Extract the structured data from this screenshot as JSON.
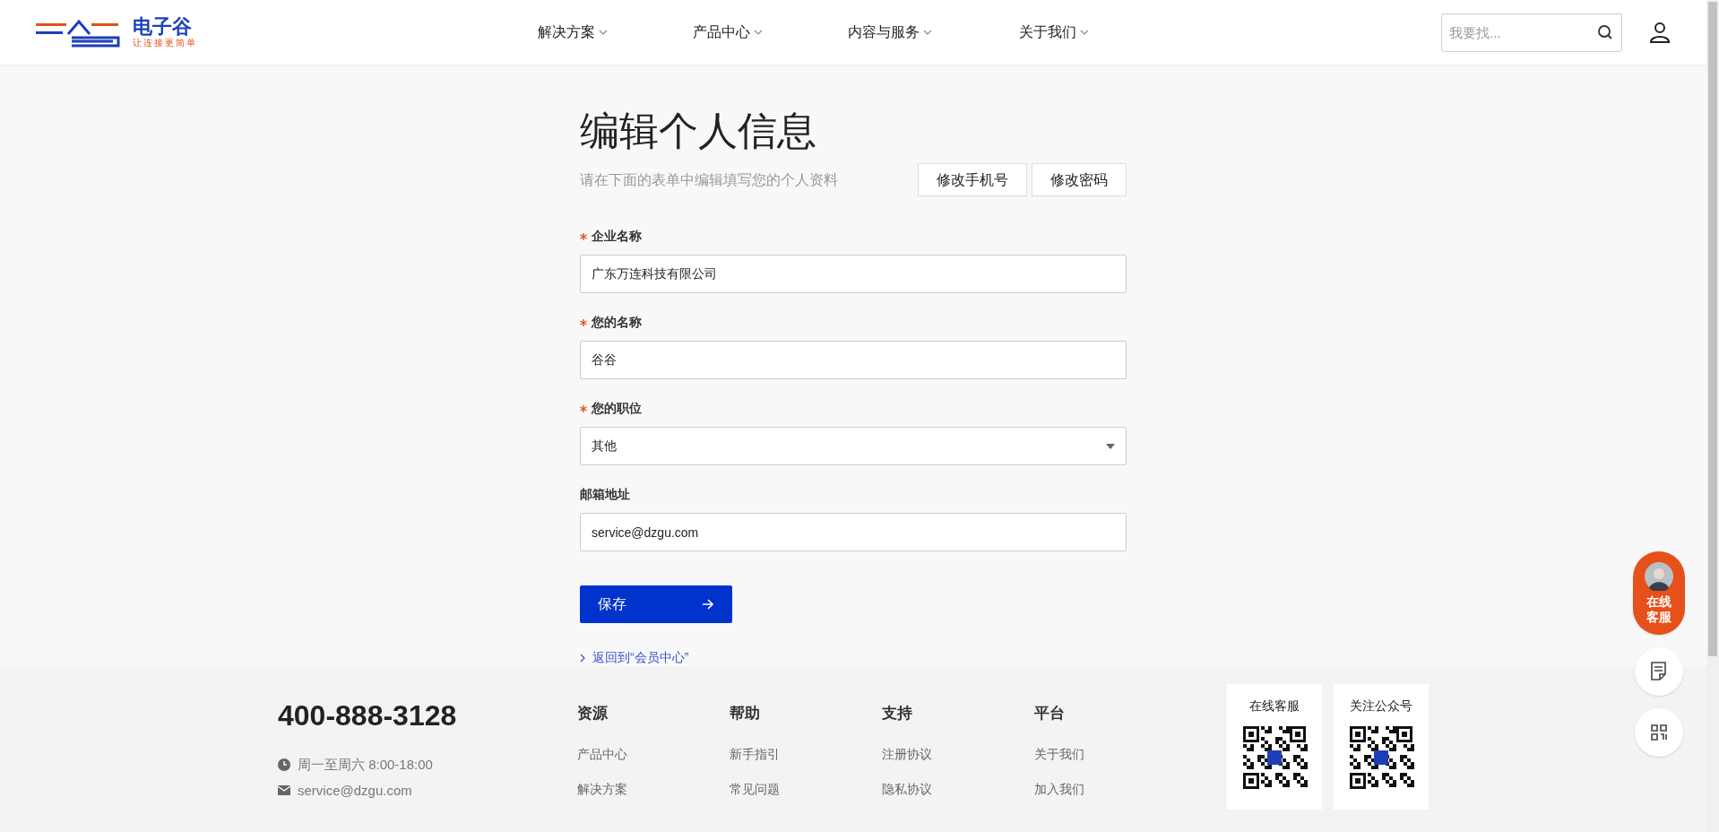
{
  "header": {
    "logo": {
      "name": "电子谷",
      "tagline": "让连接更简单"
    },
    "nav": [
      {
        "label": "解决方案",
        "selected": false
      },
      {
        "label": "产品中心",
        "selected": false
      },
      {
        "label": "内容与服务",
        "selected": false
      },
      {
        "label": "关于我们",
        "selected": false
      }
    ],
    "search": {
      "placeholder": "我要找..."
    }
  },
  "form": {
    "title": "编辑个人信息",
    "subtitle": "请在下面的表单中编辑填写您的个人资料",
    "actions": [
      "修改手机号",
      "修改密码"
    ],
    "fields": [
      {
        "kind": "text",
        "label": "企业名称",
        "required": true,
        "value": "广东万连科技有限公司"
      },
      {
        "kind": "text",
        "label": "您的名称",
        "required": true,
        "value": "谷谷"
      },
      {
        "kind": "select",
        "label": "您的职位",
        "required": true,
        "value": "其他"
      },
      {
        "kind": "text",
        "label": "邮箱地址",
        "required": false,
        "value": "service@dzgu.com"
      }
    ],
    "submit": "保存",
    "back_link": "返回到“会员中心”"
  },
  "float_bar": {
    "chat": "在线客服"
  },
  "footer": {
    "phone": "400-888-3128",
    "hours": "周一至周六 8:00-18:00",
    "email": "service@dzgu.com",
    "columns": [
      {
        "title": "资源",
        "links": [
          "产品中心",
          "解决方案"
        ]
      },
      {
        "title": "帮助",
        "links": [
          "新手指引",
          "常见问题"
        ]
      },
      {
        "title": "支持",
        "links": [
          "注册协议",
          "隐私协议"
        ]
      },
      {
        "title": "平台",
        "links": [
          "关于我们",
          "加入我们"
        ]
      }
    ],
    "qr_cards": [
      "在线客服",
      "关注公众号"
    ]
  }
}
